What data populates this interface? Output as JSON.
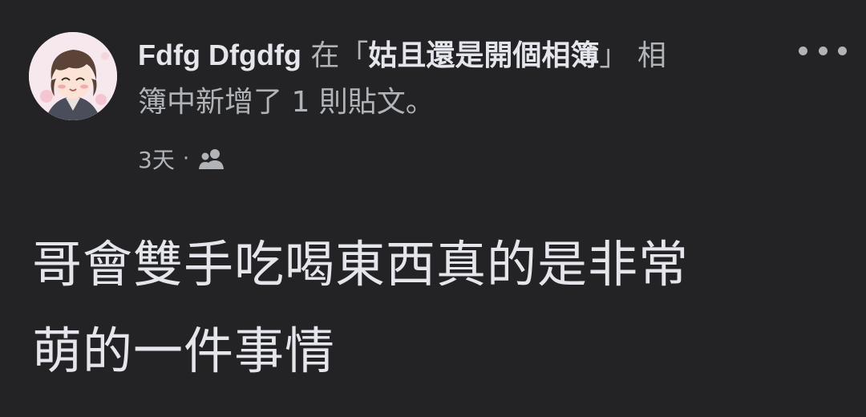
{
  "post": {
    "author": "Fdfg Dfgdfg",
    "connector": "在",
    "bracket_open": "「",
    "album_title": "姑且還是開個相簿",
    "bracket_close": "」",
    "action_line1": "相",
    "action_line2": "簿中新增了 1 則貼文。",
    "timestamp": "3天",
    "separator": "·",
    "audience_icon": "friends-icon",
    "body_line1": "哥會雙手吃喝東西真的是非常",
    "body_line2": "萌的一件事情"
  },
  "colors": {
    "background": "#232326",
    "primary_text": "#e4e6eb",
    "secondary_text": "#b0b3b8"
  }
}
